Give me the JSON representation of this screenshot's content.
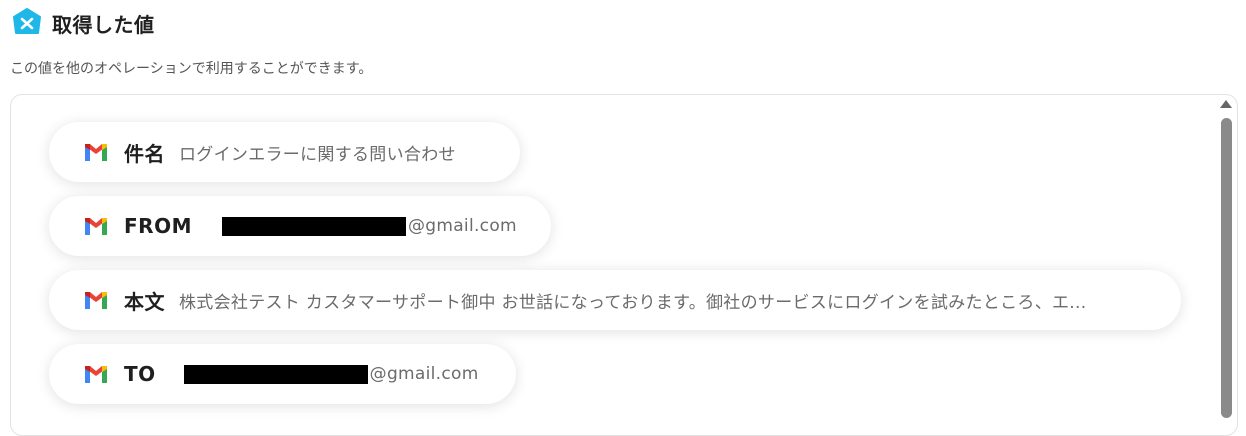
{
  "section": {
    "title": "取得した値",
    "description": "この値を他のオペレーションで利用することができます。"
  },
  "brand_color": "#1fb6e8",
  "rows": [
    {
      "icon": "gmail-icon",
      "label": "件名",
      "value": "ログインエラーに関する問い合わせ"
    },
    {
      "icon": "gmail-icon",
      "label": "FROM",
      "value_suffix": "@gmail.com",
      "redacted": true
    },
    {
      "icon": "gmail-icon",
      "label": "本文",
      "value": "株式会社テスト カスタマーサポート御中 お世話になっております。御社のサービスにログインを試みたところ、エ..."
    },
    {
      "icon": "gmail-icon",
      "label": "TO",
      "value_suffix": "@gmail.com",
      "redacted": true
    }
  ]
}
